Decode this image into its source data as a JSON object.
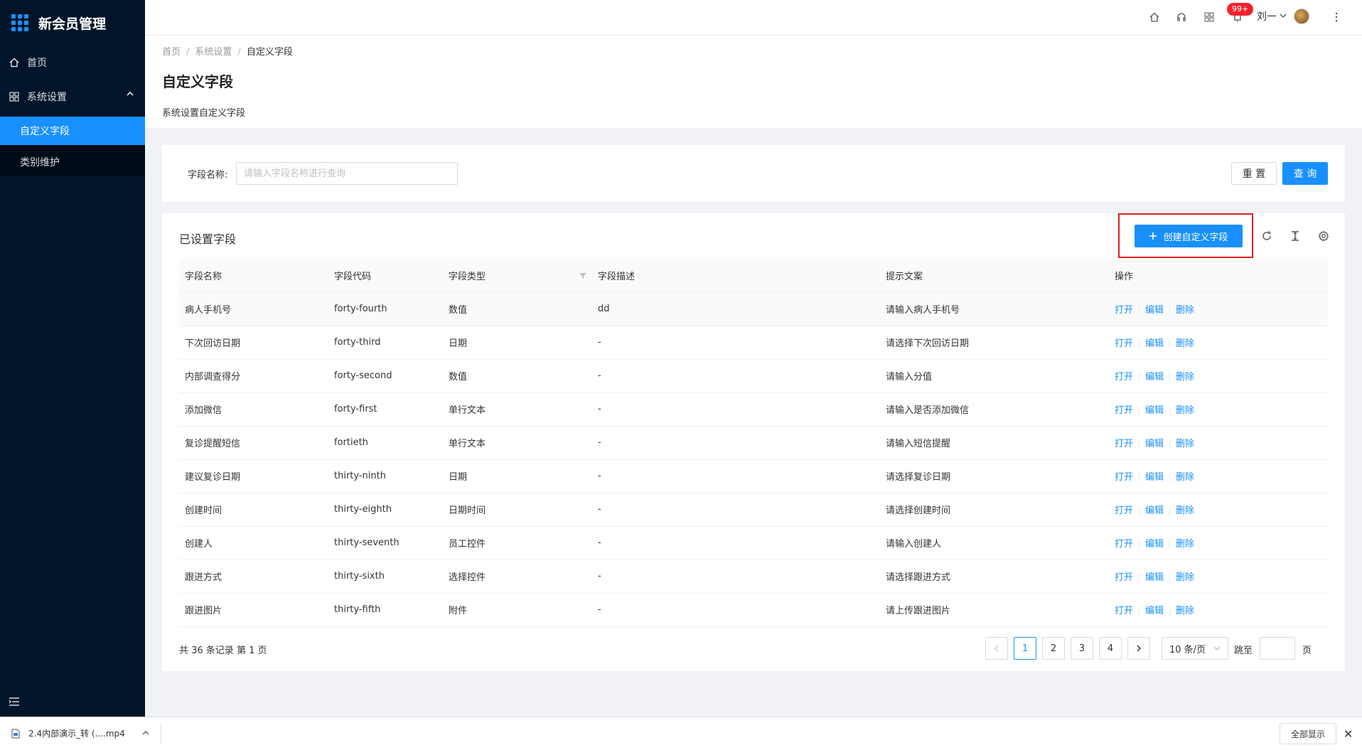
{
  "app": {
    "title": "新会员管理"
  },
  "sidebar": {
    "home": "首页",
    "settings": "系统设置",
    "sub_items": [
      "自定义字段",
      "类别维护"
    ]
  },
  "header": {
    "badge": "99+",
    "user": "刘一"
  },
  "breadcrumb": [
    "首页",
    "系统设置",
    "自定义字段"
  ],
  "page": {
    "title": "自定义字段",
    "desc": "系统设置自定义字段"
  },
  "search": {
    "label": "字段名称:",
    "placeholder": "请输入字段名称进行查询",
    "reset": "重 置",
    "query": "查 询"
  },
  "table": {
    "title": "已设置字段",
    "create_label": "创建自定义字段",
    "columns": [
      "字段名称",
      "字段代码",
      "字段类型",
      "字段描述",
      "提示文案",
      "操作"
    ],
    "actions": [
      "打开",
      "编辑",
      "删除"
    ],
    "rows": [
      [
        "病人手机号",
        "forty-fourth",
        "数值",
        "dd",
        "请输入病人手机号"
      ],
      [
        "下次回访日期",
        "forty-third",
        "日期",
        "-",
        "请选择下次回访日期"
      ],
      [
        "内部调查得分",
        "forty-second",
        "数值",
        "-",
        "请输入分值"
      ],
      [
        "添加微信",
        "forty-first",
        "单行文本",
        "-",
        "请输入是否添加微信"
      ],
      [
        "复诊提醒短信",
        "fortieth",
        "单行文本",
        "-",
        "请输入短信提醒"
      ],
      [
        "建议复诊日期",
        "thirty-ninth",
        "日期",
        "-",
        "请选择复诊日期"
      ],
      [
        "创建时间",
        "thirty-eighth",
        "日期时间",
        "-",
        "请选择创建时间"
      ],
      [
        "创建人",
        "thirty-seventh",
        "员工控件",
        "-",
        "请输入创建人"
      ],
      [
        "跟进方式",
        "thirty-sixth",
        "选择控件",
        "-",
        "请选择跟进方式"
      ],
      [
        "跟进图片",
        "thirty-fifth",
        "附件",
        "-",
        "请上传跟进图片"
      ]
    ]
  },
  "pagination": {
    "total_text": "共 36 条记录 第 1 页",
    "pages": [
      "1",
      "2",
      "3",
      "4"
    ],
    "current": "1",
    "page_size": "10 条/页",
    "jump_label": "跳至",
    "page_suffix": "页"
  },
  "downloads": {
    "file": "2.4内部演示_转 (....mp4",
    "show_all": "全部显示"
  },
  "colors": {
    "sidebar": "#001529",
    "primary": "#1890ff",
    "highlight": "#e02020"
  }
}
